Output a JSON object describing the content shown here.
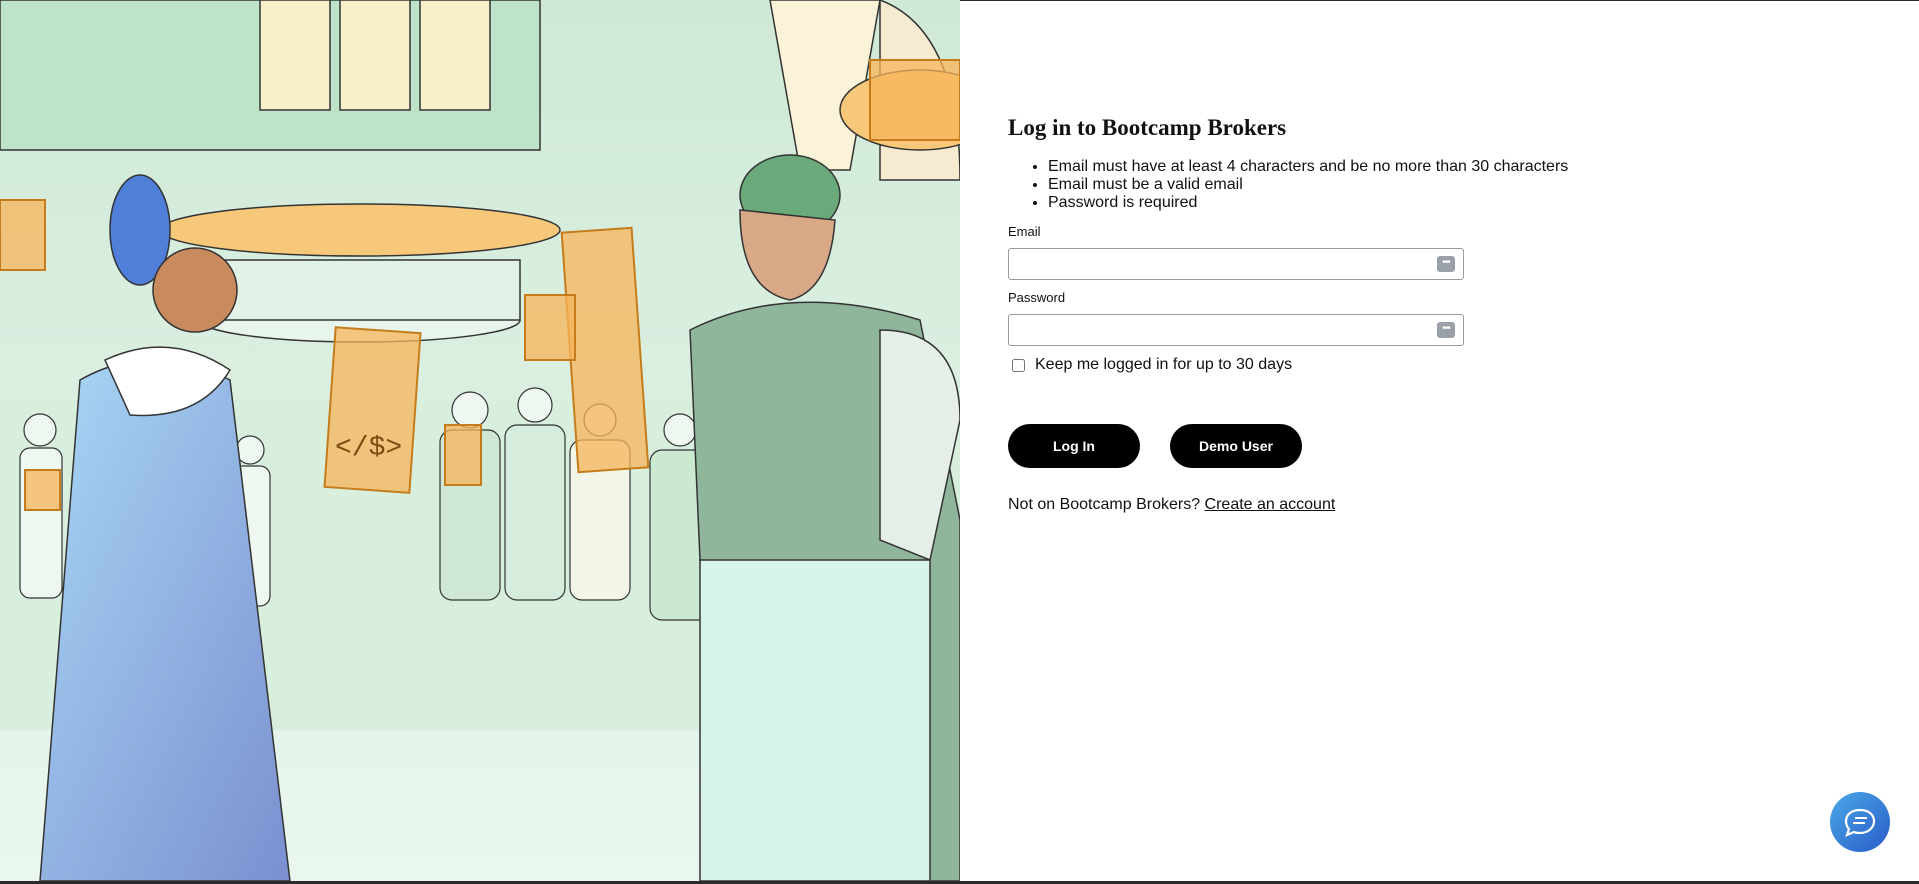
{
  "login": {
    "title": "Log in to Bootcamp Brokers",
    "errors": [
      "Email must have at least 4 characters and be no more than 30 characters",
      "Email must be a valid email",
      "Password is required"
    ],
    "email_label": "Email",
    "email_value": "",
    "password_label": "Password",
    "password_value": "",
    "remember_label": "Keep me logged in for up to 30 days",
    "remember_checked": false,
    "login_button": "Log In",
    "demo_button": "Demo User",
    "signup_prompt": "Not on Bootcamp Brokers?",
    "signup_link": "Create an account"
  },
  "icons": {
    "password_manager": "password-manager-icon",
    "chat": "chat-bubble-icon"
  },
  "colors": {
    "button_bg": "#000000",
    "chat_gradient_start": "#4aa8e8",
    "chat_gradient_end": "#2a5bc8",
    "illustration_tint": "#dff2e6",
    "panel_orange": "#f7b45a"
  }
}
